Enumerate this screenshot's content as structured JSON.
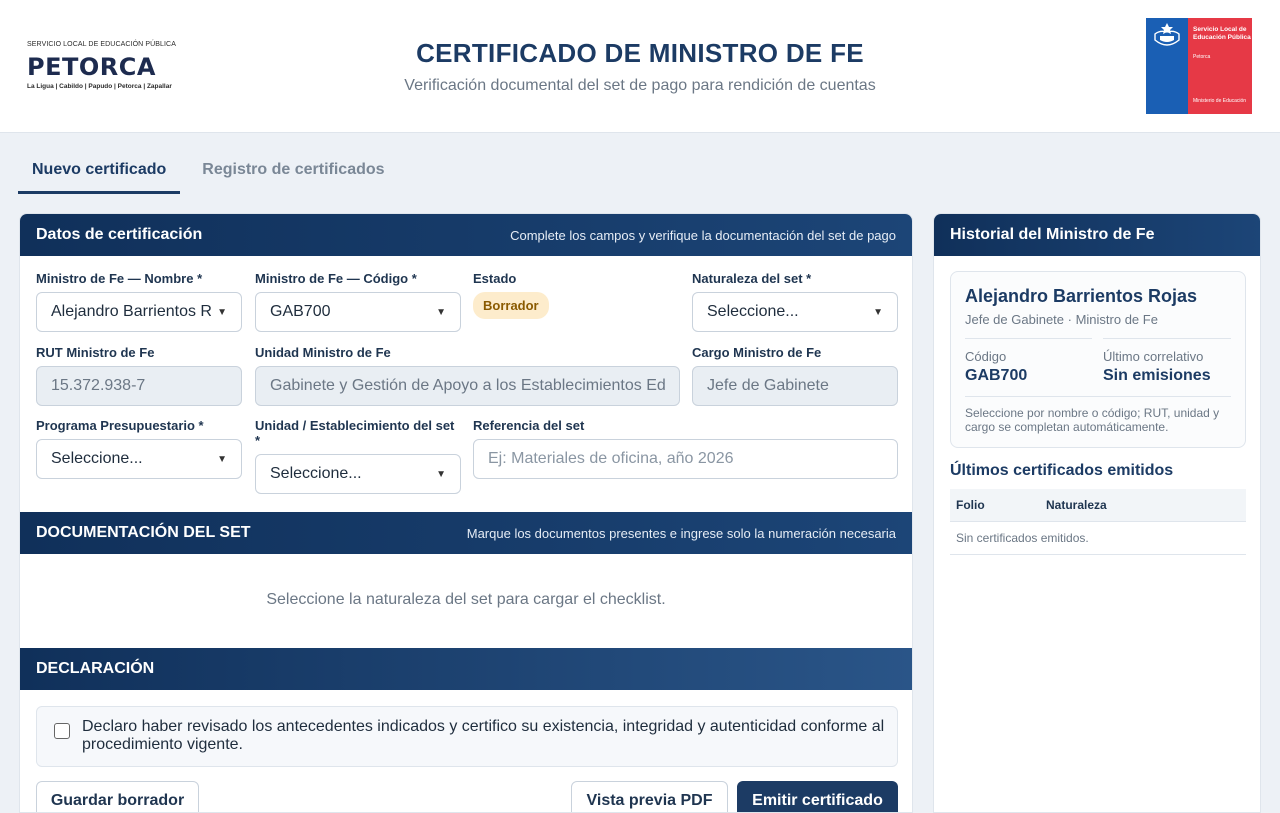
{
  "header": {
    "logo_left": {
      "tagline": "SERVICIO LOCAL DE EDUCACIÓN PÚBLICA",
      "brand": "PETORCA",
      "communes": "La Ligua | Cabildo | Papudo | Petorca | Zapallar"
    },
    "title": "CERTIFICADO DE MINISTRO DE FE",
    "subtitle": "Verificación documental del set de pago para rendición de cuentas",
    "logo_right": {
      "line1": "Servicio Local de Educación Pública",
      "line2": "Petorca",
      "line3": "Ministerio de Educación",
      "colors": {
        "blue": "#1a5fb4",
        "red": "#e63946"
      }
    }
  },
  "tabs": [
    {
      "label": "Nuevo certificado",
      "active": true
    },
    {
      "label": "Registro de certificados",
      "active": false
    }
  ],
  "cert": {
    "title": "Datos de certificación",
    "hint": "Complete los campos y verifique la documentación del set de pago",
    "fields": {
      "nombre": {
        "label": "Ministro de Fe — Nombre *",
        "value": "Alejandro Barrientos Rojas"
      },
      "codigo": {
        "label": "Ministro de Fe — Código *",
        "value": "GAB700"
      },
      "estado": {
        "label": "Estado",
        "value": "Borrador"
      },
      "naturaleza": {
        "label": "Naturaleza del set *",
        "value": "Seleccione..."
      },
      "rut": {
        "label": "RUT Ministro de Fe",
        "value": "15.372.938-7"
      },
      "unidad": {
        "label": "Unidad Ministro de Fe",
        "value": "Gabinete y Gestión de Apoyo a los Establecimientos Educacionales"
      },
      "cargo": {
        "label": "Cargo Ministro de Fe",
        "value": "Jefe de Gabinete"
      },
      "programa": {
        "label": "Programa Presupuestario *",
        "value": "Seleccione..."
      },
      "establecimiento": {
        "label": "Unidad / Establecimiento del set *",
        "value": "Seleccione..."
      },
      "referencia": {
        "label": "Referencia del set",
        "placeholder": "Ej: Materiales de oficina, año 2026"
      }
    }
  },
  "documentacion": {
    "title": "DOCUMENTACIÓN DEL SET",
    "hint": "Marque los documentos presentes e ingrese solo la numeración necesaria",
    "empty": "Seleccione la naturaleza del set para cargar el checklist."
  },
  "declaracion": {
    "title": "DECLARACIÓN",
    "text": "Declaro haber revisado los antecedentes indicados y certifico su existencia, integridad y autenticidad conforme al procedimiento vigente.",
    "checked": false
  },
  "actions": {
    "save": "Guardar borrador",
    "preview": "Vista previa PDF",
    "emit": "Emitir certificado"
  },
  "side": {
    "title": "Historial del Ministro de Fe",
    "name": "Alejandro Barrientos Rojas",
    "role": "Jefe de Gabinete · Ministro de Fe",
    "code_label": "Código",
    "code_value": "GAB700",
    "last_label": "Último correlativo",
    "last_value": "Sin emisiones",
    "note": "Seleccione por nombre o código; RUT, unidad y cargo se completan automáticamente.",
    "recent_title": "Últimos certificados emitidos",
    "table_headers": [
      "Folio",
      "Naturaleza"
    ],
    "table_empty": "Sin certificados emitidos."
  }
}
